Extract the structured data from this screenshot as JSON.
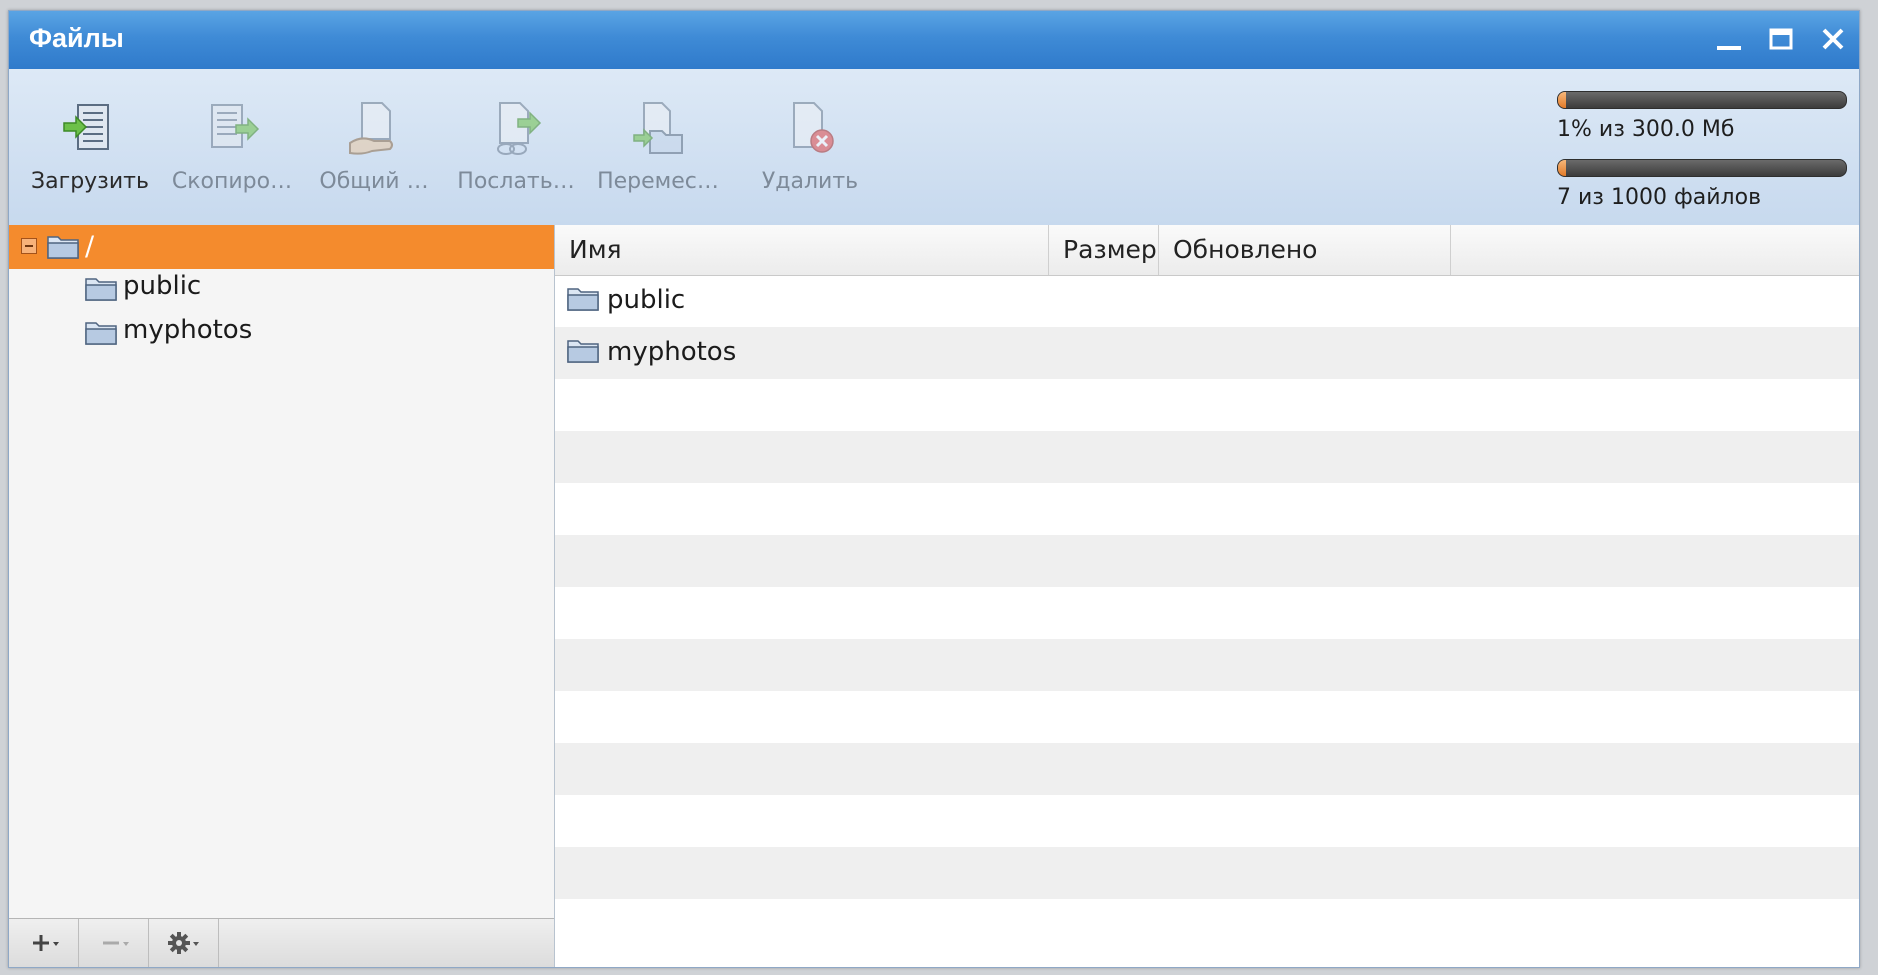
{
  "window": {
    "title": "Файлы"
  },
  "toolbar": {
    "upload_label": "Загрузить",
    "copy_label": "Скопиро…",
    "share_label": "Общий …",
    "send_label": "Послать…",
    "move_label": "Перемес…",
    "delete_label": "Удалить"
  },
  "quota": {
    "space_text": "1% из 300.0 Мб",
    "space_percent": 1,
    "files_text": "7 из 1000 файлов",
    "files_fraction": 0.007
  },
  "tree": {
    "root": "/",
    "items": [
      {
        "label": "public"
      },
      {
        "label": "myphotos"
      }
    ]
  },
  "grid": {
    "columns": {
      "name": "Имя",
      "size": "Размер",
      "updated": "Обновлено"
    },
    "rows": [
      {
        "name": "public",
        "size": "",
        "updated": ""
      },
      {
        "name": "myphotos",
        "size": "",
        "updated": ""
      }
    ]
  },
  "colors": {
    "titlebar": "#3f8bd6",
    "selection": "#f48b2d",
    "toolbar": "#d3e3f3"
  },
  "icons": {
    "upload": "upload-server-icon",
    "copy": "copy-document-icon",
    "share": "share-hand-icon",
    "send": "send-link-icon",
    "move": "move-folder-icon",
    "delete": "delete-document-icon"
  }
}
